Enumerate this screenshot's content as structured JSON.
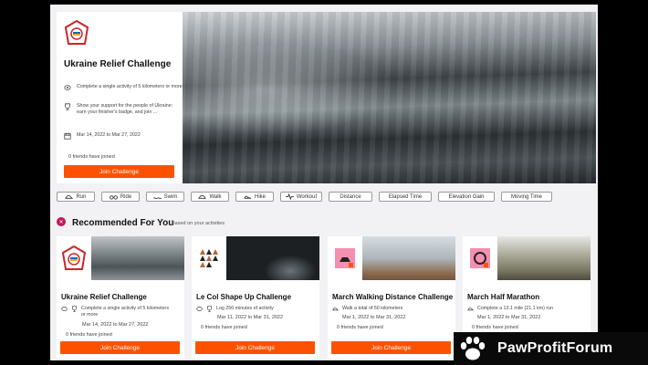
{
  "hero": {
    "title": "Ukraine Relief Challenge",
    "goal": "Complete a single activity of 5 kilometers or more",
    "description": "Show your support for the people of Ukraine: earn your finisher's badge, and join ...",
    "dates": "Mar 14, 2022 to Mar 27, 2022",
    "friends": "0 friends have joined",
    "join_label": "Join Challenge"
  },
  "filters": [
    "Run",
    "Ride",
    "Swim",
    "Walk",
    "Hike",
    "Workout",
    "Distance",
    "Elapsed Time",
    "Elevation Gain",
    "Moving Time"
  ],
  "recommended": {
    "title": "Recommended For You",
    "subtitle": "Based on your activities",
    "cards": [
      {
        "title": "Ukraine Relief Challenge",
        "goal": "Complete a single activity of 5 kilometers or more",
        "dates": "Mar 14, 2022 to Mar 27, 2022",
        "friends": "0 friends have joined",
        "join_label": "Join Challenge"
      },
      {
        "title": "Le Col Shape Up Challenge",
        "goal": "Log 250 minutes of activity",
        "dates": "Mar 11, 2022 to Mar 31, 2022",
        "friends": "0 friends have joined",
        "join_label": "Join Challenge"
      },
      {
        "title": "March Walking Distance Challenge",
        "goal": "Walk a total of 50 kilometers",
        "dates": "Mar 1, 2022 to Mar 31, 2022",
        "friends": "0 friends have joined",
        "join_label": "Join Challenge"
      },
      {
        "title": "March Half Marathon",
        "goal": "Complete a 13.1 mile (21.1 km) run",
        "dates": "Mar 1, 2022 to Mar 31, 2022",
        "friends": "0 friends have joined",
        "join_label": "Join Challenge"
      }
    ]
  },
  "watermark": {
    "text": "PawProfitForum"
  },
  "colors": {
    "accent": "#fc5200",
    "badge": "#c2185b",
    "page_bg": "#f2f2f4"
  }
}
